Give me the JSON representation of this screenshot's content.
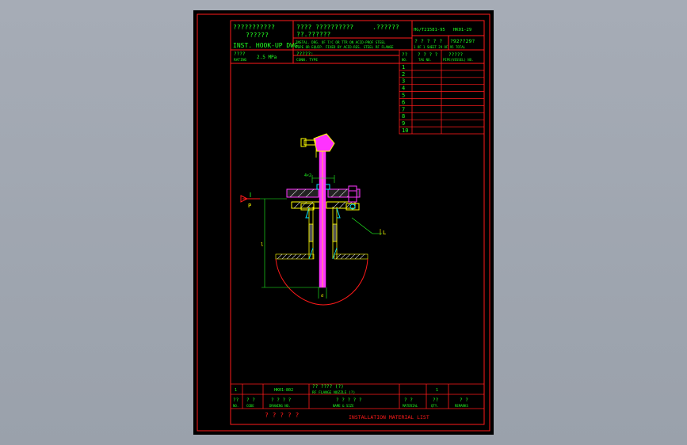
{
  "title_block": {
    "cn_title_1": "???????????",
    "cn_title_2": "??????",
    "en_title": "INST. HOOK-UP DWG.",
    "cn_desc_1": "???? ??????????",
    "cn_desc_2": ".??????",
    "cn_desc_3": "??.??????",
    "en_desc_1": "INSTAL. DRG. OF T/C OR TTR ON ACID-PROF STEEL",
    "en_desc_2": "PIPE OR EQUIP. FIXED BY ACID-RES. STEEL RF FLANGE",
    "std_code": "HG/T21581-95",
    "dwg_no": "HK01-29",
    "sheet_cn_1": "? ? ? ? ?",
    "sheet_cn_2": "?92??29?",
    "sheet_en": "1 OF 1 SHEET 29 OF 95 TOTAL",
    "rating_cn": "????",
    "rating_en": "RATING",
    "rating_val": "2.5 MPa",
    "conn_cn": "?????:",
    "conn_en": "CONN. TYPE"
  },
  "pipe_table": {
    "headers_cn": [
      "??",
      "? ? ? ?",
      "?????"
    ],
    "headers_en": [
      "NO.",
      "TAG NO.",
      "PIPE(VESSEL) NO."
    ],
    "rows": [
      "1",
      "2",
      "3",
      "4",
      "5",
      "6",
      "7",
      "8",
      "9",
      "10"
    ]
  },
  "drawing_labels": {
    "bolt_note": "4×2",
    "label_p": "P",
    "label_l": "L",
    "label_dim_l": "l",
    "label_d": "d"
  },
  "material_list": {
    "item_no": "1",
    "code": "HK01-802",
    "name_cn": "?? ???? (?)",
    "name_en": "RF FLANGE NOZZLE (?)",
    "qty": "1",
    "headers_cn": [
      "??",
      "? ?",
      "? ? ? ?",
      "? ? ? ? ?",
      "? ?",
      "??",
      "? ?"
    ],
    "headers_en": [
      "NO.",
      "CODE",
      "DRAWING NO.",
      "NAME & SIZE",
      "MATERIAL",
      "QTY.",
      "REMARKS"
    ],
    "footer_cn": "? ? ? ? ?",
    "footer_en": "INSTALLATION MATERIAL LIST"
  },
  "colors": {
    "frame": "#ff1a1a",
    "text_green": "#22ff22",
    "part_yellow": "#ffff00",
    "part_magenta": "#ff33ff",
    "part_cyan": "#00e5ff",
    "dim_green": "#22ff22",
    "hatch_white": "#d0d0d0"
  }
}
